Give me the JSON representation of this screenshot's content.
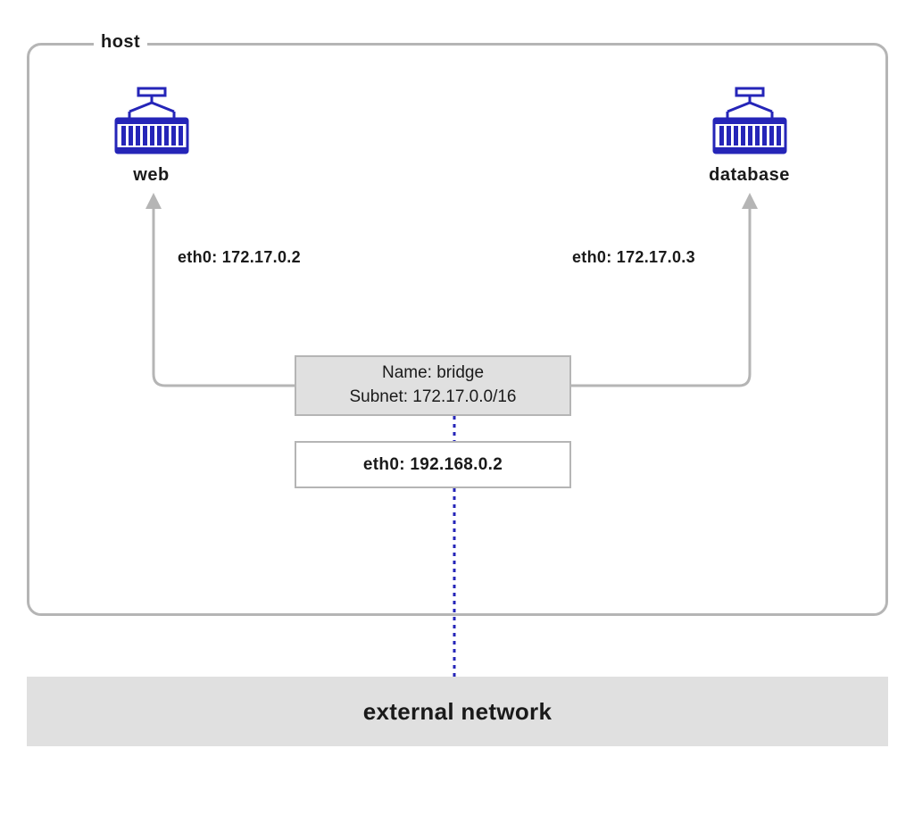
{
  "host": {
    "label": "host"
  },
  "containers": {
    "web": {
      "label": "web",
      "interface": "eth0: 172.17.0.2"
    },
    "database": {
      "label": "database",
      "interface": "eth0: 172.17.0.3"
    }
  },
  "bridge": {
    "name_label": "Name: bridge",
    "subnet_label": "Subnet: 172.17.0.0/16"
  },
  "host_interface": {
    "label": "eth0: 192.168.0.2"
  },
  "external": {
    "label": "external network"
  }
}
